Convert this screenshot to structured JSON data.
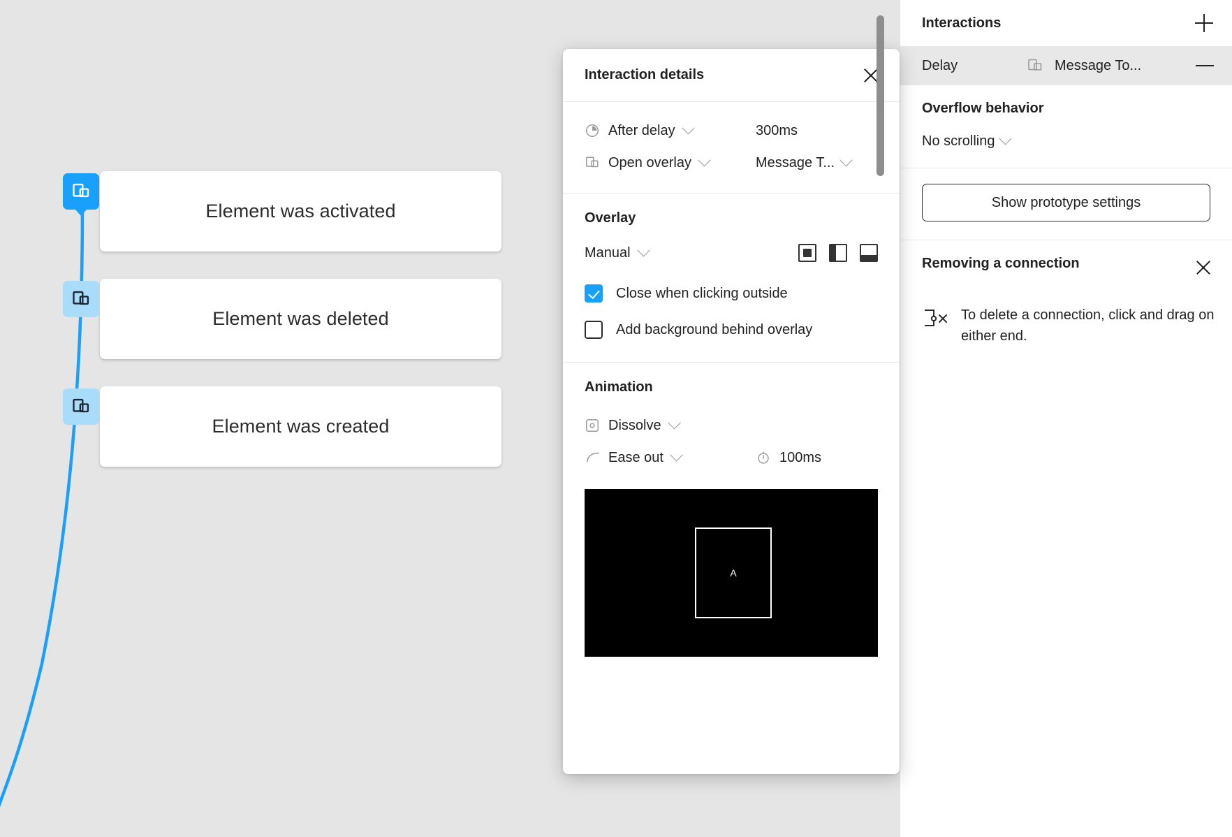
{
  "canvas": {
    "cards": [
      {
        "label": "Element was activated",
        "pin_state": "active",
        "pin_icon": "overlay-icon"
      },
      {
        "label": "Element was deleted",
        "pin_state": "idle",
        "pin_icon": "overlay-icon"
      },
      {
        "label": "Element was created",
        "pin_state": "idle",
        "pin_icon": "overlay-icon"
      }
    ],
    "connection_color": "#18a0fb",
    "background": "#e5e5e5",
    "scrollbar_color": "#8e8e8e"
  },
  "interaction_details": {
    "title": "Interaction details",
    "close_icon": "close-icon",
    "trigger": {
      "icon": "clock-icon",
      "label": "After delay",
      "value": "300ms"
    },
    "action": {
      "icon": "overlay-icon",
      "label": "Open overlay",
      "value": "Message T..."
    },
    "overlay": {
      "section_title": "Overlay",
      "position_mode": "Manual",
      "position_icons": [
        "overlay-position-center-icon",
        "overlay-position-left-icon",
        "overlay-position-bottom-icon"
      ],
      "checkboxes": [
        {
          "label": "Close when clicking outside",
          "checked": true
        },
        {
          "label": "Add background behind overlay",
          "checked": false
        }
      ]
    },
    "animation": {
      "section_title": "Animation",
      "type_icon": "dissolve-icon",
      "type": "Dissolve",
      "easing_icon": "ease-curve-icon",
      "easing": "Ease out",
      "duration_icon": "stopwatch-icon",
      "duration": "100ms",
      "preview": {
        "background": "#000000",
        "frame_label": "A"
      }
    }
  },
  "right_panel": {
    "header": {
      "title": "Interactions",
      "add_icon": "plus-icon"
    },
    "interaction_row": {
      "trigger": "Delay",
      "action_icon": "overlay-icon",
      "destination": "Message To...",
      "remove_icon": "minus-icon",
      "highlighted": true
    },
    "overflow": {
      "title": "Overflow behavior",
      "value": "No scrolling"
    },
    "prototype_button": "Show prototype settings",
    "hint": {
      "title": "Removing a connection",
      "close_icon": "close-icon",
      "icon": "delete-connection-icon",
      "text": "To delete a connection, click and drag on either end."
    }
  },
  "colors": {
    "accent": "#18a0fb",
    "accent_soft": "#a9dcfb",
    "panel_bg": "#ffffff",
    "canvas_bg": "#e5e5e5",
    "row_highlight": "#e8e8e8",
    "text": "#222222"
  }
}
